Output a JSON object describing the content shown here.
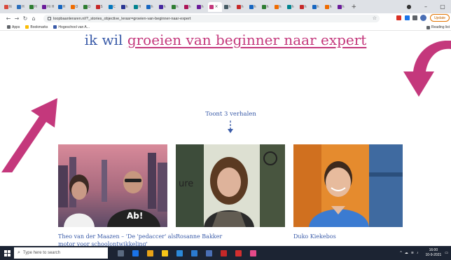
{
  "browser": {
    "tabs": [
      {
        "label": "N",
        "color": "#d94a3d"
      },
      {
        "label": "H",
        "color": "#2a6ebb"
      },
      {
        "label": "H",
        "color": "#2e7d32"
      },
      {
        "label": "Hi H",
        "color": "#6a1b9a"
      },
      {
        "label": "H",
        "color": "#1565c0"
      },
      {
        "label": "O",
        "color": "#ef6c00"
      },
      {
        "label": "O",
        "color": "#2e7d32"
      },
      {
        "label": "S",
        "color": "#c62828"
      },
      {
        "label": "C",
        "color": "#0277bd"
      },
      {
        "label": "h",
        "color": "#283593"
      },
      {
        "label": "H",
        "color": "#00838f"
      },
      {
        "label": "h",
        "color": "#1565c0"
      },
      {
        "label": "h",
        "color": "#4527a0"
      },
      {
        "label": "h",
        "color": "#2e7d32"
      },
      {
        "label": "h",
        "color": "#ad1457"
      },
      {
        "label": "h",
        "color": "#6a1b9a"
      }
    ],
    "active_tab_close": "×",
    "tabs_after": [
      {
        "label": "h",
        "color": "#455a64"
      },
      {
        "label": "h",
        "color": "#c62828"
      },
      {
        "label": "h",
        "color": "#1565c0"
      },
      {
        "label": "h",
        "color": "#2e7d32"
      },
      {
        "label": "h",
        "color": "#ef6c00"
      },
      {
        "label": "h",
        "color": "#00838f"
      },
      {
        "label": "h",
        "color": "#c62828"
      },
      {
        "label": "h",
        "color": "#1565c0"
      },
      {
        "label": "h",
        "color": "#ef6c00"
      },
      {
        "label": "h",
        "color": "#6a1b9a"
      }
    ],
    "new_tab": "+",
    "url": "loopbaanleraren.nl/?_stories_objective_lerasr=groeien-van-beginner-naar-expert",
    "update_label": "Update",
    "bookmarks": [
      {
        "label": "Apps",
        "color": "#5f6368"
      },
      {
        "label": "Bookmarks",
        "color": "#fbbc04"
      },
      {
        "label": "Hogeschool van A...",
        "color": "#3a5ba8"
      }
    ],
    "reading_list": "Reading list"
  },
  "page": {
    "headline_prefix": "ik wil",
    "headline_highlight": "groeien van beginner naar expert",
    "count_text": "Toont 3 verhalen",
    "accent_color": "#c4387c",
    "text_color": "#3a5ba8",
    "stories": [
      {
        "caption": "Theo van der Maazen – 'De 'pedaccer' als motor voor schoolontwikkeling'"
      },
      {
        "caption": "Rosanne Bakker"
      },
      {
        "caption": "Duko Kiekebos"
      }
    ]
  },
  "taskbar": {
    "search_placeholder": "Type here to search",
    "time": "16:00",
    "date": "10-9-2021"
  }
}
